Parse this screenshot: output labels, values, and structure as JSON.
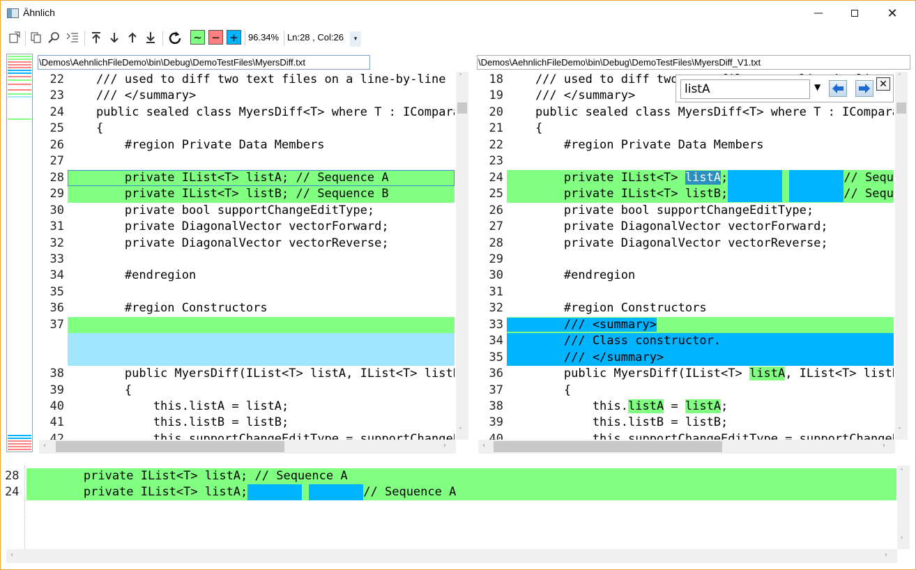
{
  "window": {
    "title": "Ähnlich",
    "min": "—",
    "close": "✕"
  },
  "toolbar": {
    "zoom": "96.34%",
    "position": "Ln:28 , Col:26",
    "btn_changed": "~",
    "btn_deleted": "−",
    "btn_added": "+",
    "colors": {
      "changed": "#80ff80",
      "deleted": "#ff8080",
      "added": "#00b4ff"
    }
  },
  "left": {
    "path": "\\Demos\\AehnlichFileDemo\\bin\\Debug\\DemoTestFiles\\MyersDiff.txt",
    "lines": [
      {
        "n": "22",
        "t": "    /// used to diff two text files on a line-by-line",
        "cls": ""
      },
      {
        "n": "23",
        "t": "    /// </summary>",
        "cls": ""
      },
      {
        "n": "24",
        "t": "    public sealed class MyersDiff<T> where T : IComparable",
        "cls": ""
      },
      {
        "n": "25",
        "t": "    {",
        "cls": ""
      },
      {
        "n": "26",
        "t": "        #region Private Data Members",
        "cls": ""
      },
      {
        "n": "27",
        "t": "",
        "cls": ""
      },
      {
        "n": "28",
        "t": "        private IList<T> listA; // Sequence A",
        "cls": "g"
      },
      {
        "n": "29",
        "t": "        private IList<T> listB; // Sequence B",
        "cls": "g"
      },
      {
        "n": "30",
        "t": "        private bool supportChangeEditType;",
        "cls": ""
      },
      {
        "n": "31",
        "t": "        private DiagonalVector vectorForward;",
        "cls": ""
      },
      {
        "n": "32",
        "t": "        private DiagonalVector vectorReverse;",
        "cls": ""
      },
      {
        "n": "33",
        "t": "",
        "cls": ""
      },
      {
        "n": "34",
        "t": "        #endregion",
        "cls": ""
      },
      {
        "n": "35",
        "t": "",
        "cls": ""
      },
      {
        "n": "36",
        "t": "        #region Constructors",
        "cls": ""
      },
      {
        "n": "37",
        "t": "",
        "cls": "g"
      },
      {
        "n": "",
        "t": "",
        "cls": "bl"
      },
      {
        "n": "",
        "t": "",
        "cls": "bl"
      },
      {
        "n": "38",
        "t": "        public MyersDiff(IList<T> listA, IList<T> listB,",
        "cls": ""
      },
      {
        "n": "39",
        "t": "        {",
        "cls": ""
      },
      {
        "n": "40",
        "t": "            this.listA = listA;",
        "cls": ""
      },
      {
        "n": "41",
        "t": "            this.listB = listB;",
        "cls": ""
      },
      {
        "n": "42",
        "t": "            this.supportChangeEditType = supportChangeEdit",
        "cls": ""
      }
    ]
  },
  "right": {
    "path": "\\Demos\\AehnlichFileDemo\\bin\\Debug\\DemoTestFiles\\MyersDiff_V1.txt",
    "lines": [
      {
        "n": "18",
        "t": "    /// used to diff two text files on a line-by-line",
        "cls": ""
      },
      {
        "n": "19",
        "t": "    /// </summary>",
        "cls": ""
      },
      {
        "n": "20",
        "t": "    public sealed class MyersDiff<T> where T : IComparable",
        "cls": ""
      },
      {
        "n": "21",
        "t": "    {",
        "cls": ""
      },
      {
        "n": "22",
        "t": "        #region Private Data Members",
        "cls": ""
      },
      {
        "n": "23",
        "t": "",
        "cls": ""
      },
      {
        "n": "24",
        "t": "",
        "cls": "g",
        "kind": "r24"
      },
      {
        "n": "25",
        "t": "",
        "cls": "g",
        "kind": "r25"
      },
      {
        "n": "26",
        "t": "        private bool supportChangeEditType;",
        "cls": ""
      },
      {
        "n": "27",
        "t": "        private DiagonalVector vectorForward;",
        "cls": ""
      },
      {
        "n": "28",
        "t": "        private DiagonalVector vectorReverse;",
        "cls": ""
      },
      {
        "n": "29",
        "t": "",
        "cls": ""
      },
      {
        "n": "30",
        "t": "        #endregion",
        "cls": ""
      },
      {
        "n": "31",
        "t": "",
        "cls": ""
      },
      {
        "n": "32",
        "t": "        #region Constructors",
        "cls": ""
      },
      {
        "n": "33",
        "t": "",
        "cls": "g",
        "kind": "r33"
      },
      {
        "n": "34",
        "t": "        /// Class constructor.",
        "cls": "cy"
      },
      {
        "n": "35",
        "t": "        /// </summary>",
        "cls": "cy"
      },
      {
        "n": "36",
        "t": "",
        "cls": "",
        "kind": "r36"
      },
      {
        "n": "37",
        "t": "        {",
        "cls": ""
      },
      {
        "n": "38",
        "t": "",
        "cls": "",
        "kind": "r38"
      },
      {
        "n": "39",
        "t": "            this.listB = listB;",
        "cls": ""
      },
      {
        "n": "40",
        "t": "            this.supportChangeEditType = supportChangeEdit",
        "cls": ""
      }
    ],
    "segments": {
      "r24_a": "        private IList<T> ",
      "r24_hl": "listA",
      "r24_b": ";",
      "r24_c": "// Sequence A",
      "r25_a": "        private IList<T> listB;",
      "r25_c": "// Sequence B",
      "r33_a": "        /// <summary>",
      "r36_a": "        public MyersDiff(IList<T> ",
      "r36_hl": "listA",
      "r36_b": ", IList<T> listB,",
      "r38_a": "            this.",
      "r38_hl1": "listA",
      "r38_b": " = ",
      "r38_hl2": "listA",
      "r38_c": ";"
    }
  },
  "find": {
    "value": "listA",
    "prev": "🡄",
    "next": "🡆",
    "close": "✕"
  },
  "bottom": {
    "n1": "28",
    "n2": "24",
    "line1": "        private IList<T> listA; // Sequence A",
    "line2a": "        private IList<T> listA;",
    "line2b": "// Sequence A"
  }
}
